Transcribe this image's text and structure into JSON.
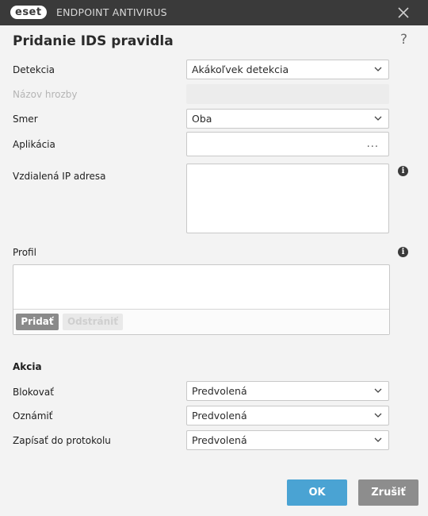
{
  "titlebar": {
    "logo": "eset",
    "product": "ENDPOINT ANTIVIRUS",
    "close_icon": "close-icon"
  },
  "dialog": {
    "title": "Pridanie IDS pravidla",
    "help": "?"
  },
  "fields": {
    "detection": {
      "label": "Detekcia",
      "value": "Akákoľvek detekcia"
    },
    "threat_name": {
      "label": "Názov hrozby",
      "value": ""
    },
    "direction": {
      "label": "Smer",
      "value": "Oba"
    },
    "application": {
      "label": "Aplikácia",
      "value": "",
      "browse": "..."
    },
    "remote_ip": {
      "label": "Vzdialená IP adresa",
      "value": ""
    }
  },
  "profile": {
    "label": "Profil",
    "add": "Pridať",
    "remove": "Odstrániť"
  },
  "action": {
    "section": "Akcia",
    "block": {
      "label": "Blokovať",
      "value": "Predvolená"
    },
    "notify": {
      "label": "Oznámiť",
      "value": "Predvolená"
    },
    "log": {
      "label": "Zapísať do protokolu",
      "value": "Predvolená"
    }
  },
  "buttons": {
    "ok": "OK",
    "cancel": "Zrušiť"
  },
  "colors": {
    "titlebar": "#3a3a3a",
    "ok": "#4aa3d3",
    "cancel": "#8d8d8d"
  }
}
